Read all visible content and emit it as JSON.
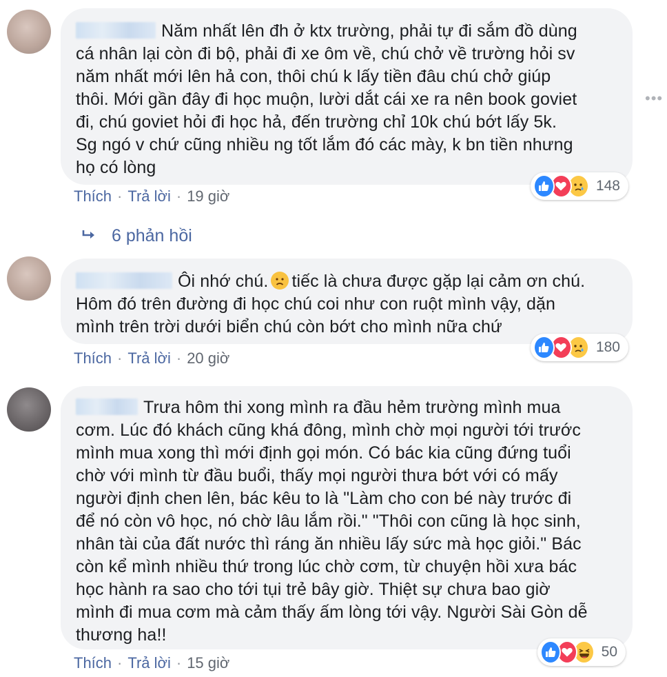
{
  "comments": [
    {
      "lines": "Năm nhất lên đh ở ktx trường, phải tự đi sắm đồ dùng\ncá nhân lại còn đi bộ, phải đi xe ôm về, chú chở về trường hỏi sv\nnăm nhất mới lên hả con, thôi chú k lấy tiền đâu chú chở giúp\nthôi. Mới gần đây đi học muộn, lười dắt cái xe ra nên book goviet\nđi, chú goviet hỏi đi học hả, đến trường chỉ 10k chú bớt lấy 5k.\nSg ngó v chứ cũng nhiều ng tốt lắm đó các mày, k bn tiền nhưng\nhọ có lòng",
      "like_label": "Thích",
      "reply_label": "Trả lời",
      "time": "19 giờ",
      "reaction_count": "148",
      "reactions": [
        "like-icon",
        "love-icon",
        "sad-icon"
      ]
    },
    {
      "first_line_a": "Ôi nhớ chú.",
      "first_line_b": "tiếc là chưa được gặp lại cảm ơn chú.",
      "lines": "Hôm đó trên đường đi học chú coi như con ruột mình vậy, dặn\nmình trên trời dưới biển chú còn bớt cho mình nữa chứ",
      "like_label": "Thích",
      "reply_label": "Trả lời",
      "time": "20 giờ",
      "reaction_count": "180",
      "reactions": [
        "like-icon",
        "love-icon",
        "sad-icon"
      ]
    },
    {
      "lines": "Trưa hôm thi xong mình ra đầu hẻm trường mình mua\ncơm. Lúc đó khách cũng khá đông, mình chờ mọi người tới trước\nmình mua xong thì mới định gọi món. Có bác kia cũng đứng tuổi\nchờ với mình từ đầu buổi, thấy mọi người thưa bớt với có mấy\nngười định chen lên, bác kêu to là \"Làm cho con bé này trước đi\nđể nó còn vô học, nó chờ lâu lắm rồi.\" \"Thôi con cũng là học sinh,\nnhân tài của đất nước thì ráng ăn nhiều lấy sức mà học giỏi.\" Bác\ncòn kể mình nhiều thứ trong lúc chờ cơm, từ chuyện hồi xưa bác\nhọc hành ra sao cho tới tụi trẻ bây giờ. Thiệt sự chưa bao giờ\nmình đi mua cơm mà cảm thấy ấm lòng tới vậy. Người Sài Gòn dễ\nthương ha!!",
      "like_label": "Thích",
      "reply_label": "Trả lời",
      "time": "15 giờ",
      "reaction_count": "50",
      "reactions": [
        "like-icon",
        "love-icon",
        "haha-icon"
      ]
    }
  ],
  "replies_link": "6 phản hồi",
  "more_icon": "more-options-icon",
  "colors": {
    "bubble": "#f2f3f5",
    "link": "#4b67a1",
    "like": "#2d88ff",
    "love": "#f33e58",
    "emoji": "#fcc845"
  }
}
